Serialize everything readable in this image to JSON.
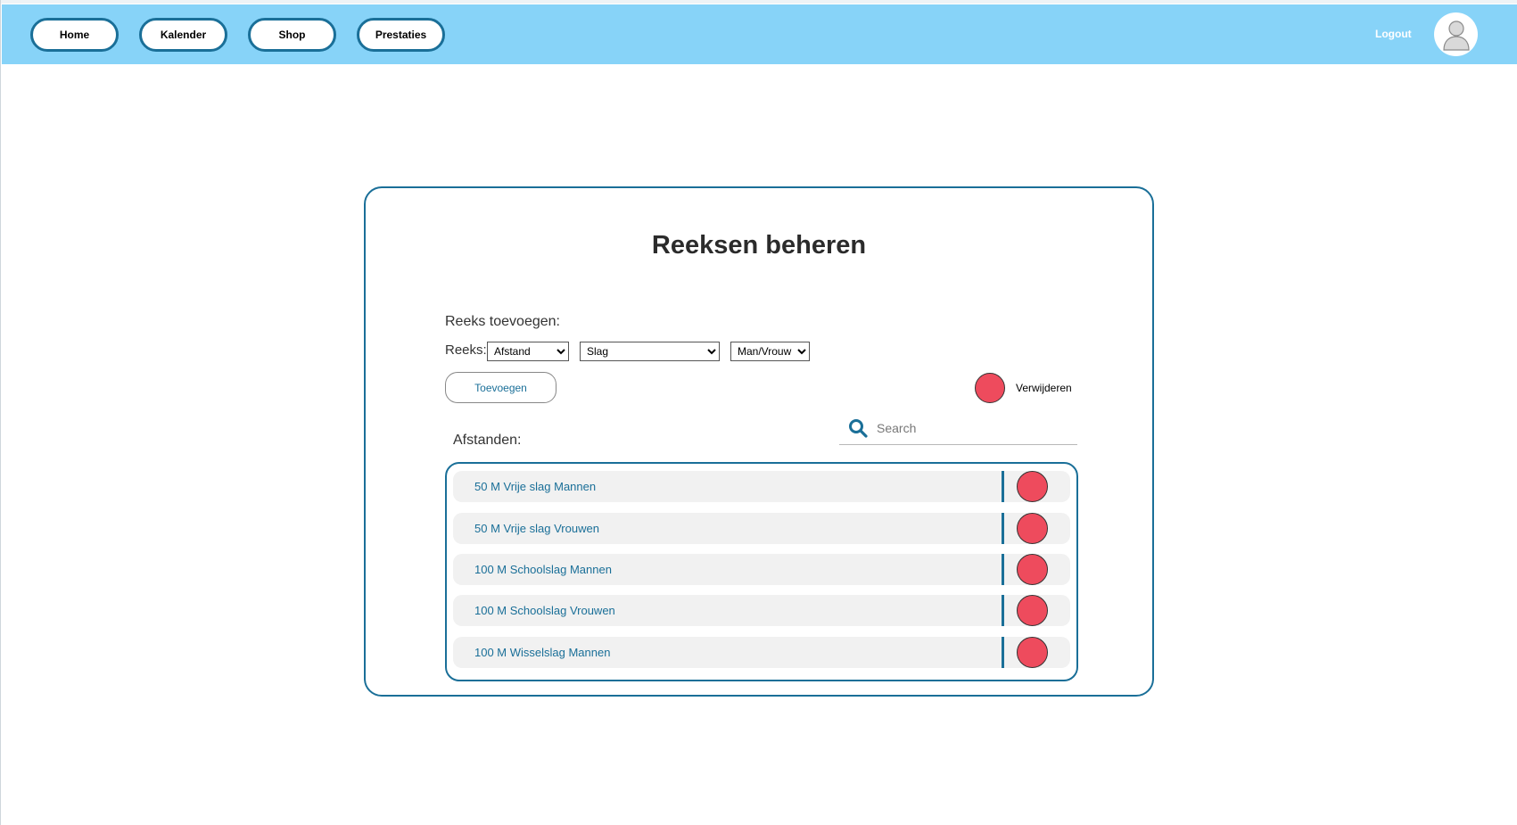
{
  "nav": {
    "items": [
      {
        "label": "Home"
      },
      {
        "label": "Kalender"
      },
      {
        "label": "Shop"
      },
      {
        "label": "Prestaties"
      }
    ],
    "logout_label": "Logout"
  },
  "colors": {
    "header_bg": "#87d3f8",
    "accent": "#1a6f98",
    "delete": "#ee4b5d"
  },
  "card": {
    "title": "Reeksen beheren",
    "add_label": "Reeks toevoegen:",
    "reeks_label": "Reeks:",
    "selects": {
      "afstand": "Afstand",
      "slag": "Slag",
      "gender": "Man/Vrouw"
    },
    "add_button": "Toevoegen",
    "delete_legend": "Verwijderen",
    "list_label": "Afstanden:",
    "search_placeholder": "Search",
    "items": [
      {
        "label": "50 M Vrije slag Mannen"
      },
      {
        "label": "50 M Vrije slag Vrouwen"
      },
      {
        "label": "100 M Schoolslag Mannen"
      },
      {
        "label": "100 M Schoolslag Vrouwen"
      },
      {
        "label": "100 M Wisselslag Mannen"
      }
    ]
  }
}
